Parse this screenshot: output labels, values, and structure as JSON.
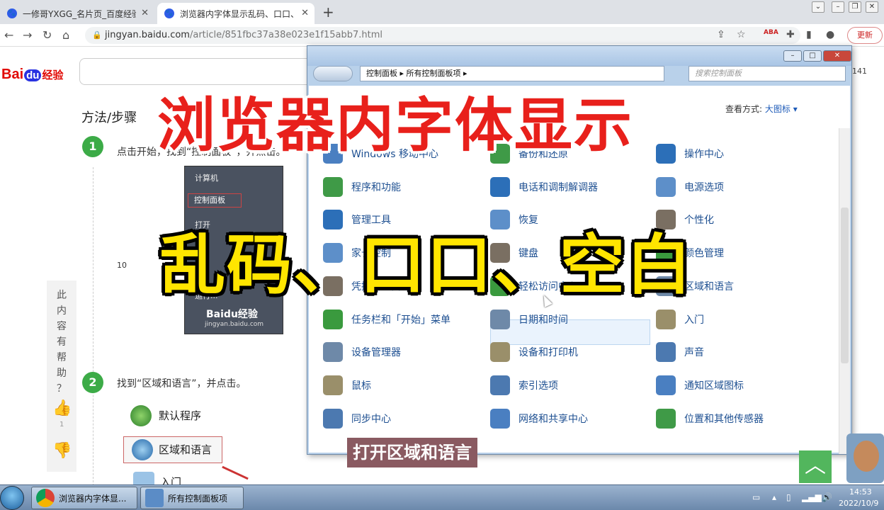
{
  "browser": {
    "tabs": [
      {
        "title": "一修哥YXGG_名片页_百度经验"
      },
      {
        "title": "浏览器内字体显示乱码、口口、空"
      }
    ],
    "url_host": "jingyan.baidu.com",
    "url_path": "/article/851fbc37a38e023e1f15abb7.html",
    "update_label": "更新",
    "ext_badge": "ABA"
  },
  "page": {
    "logo_text_bai": "Bai",
    "logo_text_du": "du",
    "logo_text_jy": "经验",
    "count": "141",
    "method_title": "方法/步骤",
    "steps": [
      {
        "num": "1",
        "text": "点击开始，找到“控制面板”，并点击。"
      },
      {
        "num": "2",
        "text": "找到“区域和语言”，并点击。"
      }
    ],
    "start_menu": {
      "items": [
        "计算机",
        "控制面板",
        "打开",
        "序",
        "运行..."
      ],
      "watermark": "Baidu经验",
      "watermark_url": "jingyan.baidu.com"
    },
    "ten": "10",
    "sidebar_help": [
      "此",
      "内",
      "容",
      "有",
      "帮",
      "助",
      "？"
    ],
    "thumb_count": "1",
    "step2_items": [
      "默认程序",
      "区域和语言",
      "入门"
    ]
  },
  "control_panel": {
    "breadcrumb_1": "控制面板",
    "breadcrumb_2": "所有控制面板项",
    "search_placeholder": "搜索控制面板",
    "view_label": "查看方式:",
    "view_value": "大图标 ▾",
    "items": [
      [
        "Windows 移动中心",
        "备份和还原",
        "操作中心"
      ],
      [
        "程序和功能",
        "电话和调制解调器",
        "电源选项"
      ],
      [
        "管理工具",
        "恢复",
        "个性化"
      ],
      [
        "家长控制",
        "键盘",
        "颜色管理"
      ],
      [
        "凭据管理器",
        "轻松访问中心",
        "区域和语言"
      ],
      [
        "任务栏和「开始」菜单",
        "日期和时间",
        "入门"
      ],
      [
        "设备管理器",
        "设备和打印机",
        "声音"
      ],
      [
        "鼠标",
        "索引选项",
        "通知区域图标"
      ],
      [
        "同步中心",
        "网络和共享中心",
        "位置和其他传感器"
      ]
    ],
    "icon_colors": [
      "#4a7fc1",
      "#3f9a47",
      "#2c6fb8",
      "#5d8fc9",
      "#7a6f62",
      "#3a9a3e",
      "#6e89a8",
      "#9a8f6a",
      "#4c79b0"
    ]
  },
  "overlay": {
    "headline": "浏览器内字体显示",
    "subline": "乱码、口口、空白",
    "subtitle": "打开区域和语言"
  },
  "taskbar": {
    "tasks": [
      "浏览器内字体显...",
      "所有控制面板项"
    ],
    "time": "14:53",
    "date": "2022/10/9"
  }
}
